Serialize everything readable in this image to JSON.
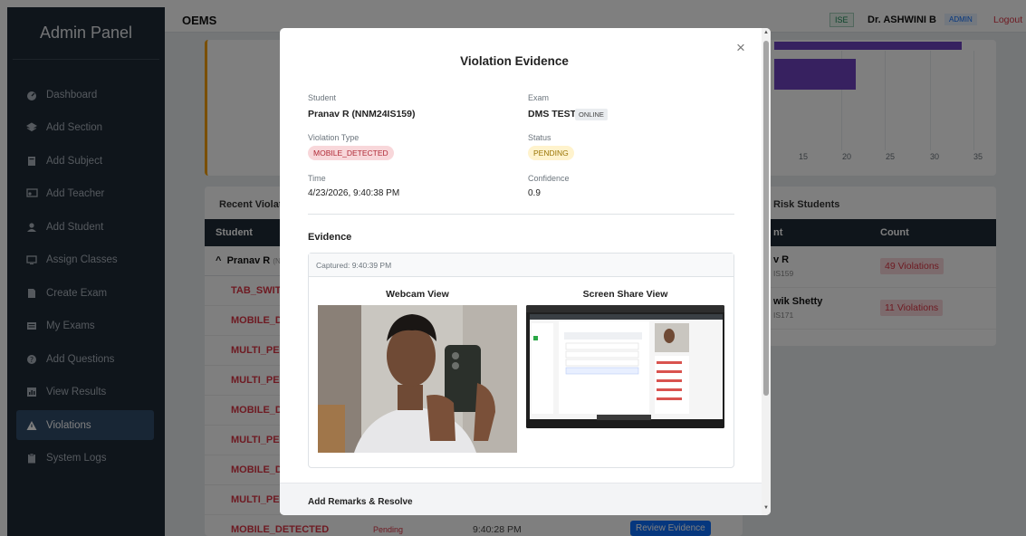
{
  "sidebar": {
    "brand": "Admin Panel",
    "items": [
      {
        "label": "Dashboard",
        "icon": "dashboard-icon"
      },
      {
        "label": "Add Section",
        "icon": "layers-icon"
      },
      {
        "label": "Add Subject",
        "icon": "book-icon"
      },
      {
        "label": "Add Teacher",
        "icon": "teacher-icon"
      },
      {
        "label": "Add Student",
        "icon": "student-icon"
      },
      {
        "label": "Assign Classes",
        "icon": "monitor-icon"
      },
      {
        "label": "Create Exam",
        "icon": "document-icon"
      },
      {
        "label": "My Exams",
        "icon": "list-icon"
      },
      {
        "label": "Add Questions",
        "icon": "question-icon"
      },
      {
        "label": "View Results",
        "icon": "chart-icon"
      },
      {
        "label": "Violations",
        "icon": "warning-icon",
        "active": true
      },
      {
        "label": "System Logs",
        "icon": "clipboard-icon"
      }
    ]
  },
  "topbar": {
    "app_name": "OEMS",
    "dept_badge": "ISE",
    "user_name": "Dr. ASHWINI B",
    "role_badge": "ADMIN",
    "logout": "Logout"
  },
  "chart": {
    "ticks": [
      "15",
      "20",
      "25",
      "30",
      "35"
    ]
  },
  "violations": {
    "title": "Recent Violati",
    "header_student": "Student",
    "group_label": "Pranav R",
    "group_suffix": "(N",
    "rows": [
      {
        "type": "TAB_SWITC"
      },
      {
        "type": "MOBILE_DE"
      },
      {
        "type": "MULTI_PER"
      },
      {
        "type": "MULTI_PER"
      },
      {
        "type": "MOBILE_DE"
      },
      {
        "type": "MULTI_PER"
      },
      {
        "type": "MOBILE_DE"
      },
      {
        "type": "MULTI_PER"
      },
      {
        "type": "MOBILE_DETECTED",
        "status": "Pending",
        "time": "9:40:28 PM",
        "action": "Review Evidence"
      }
    ]
  },
  "risk": {
    "title": "Risk Students",
    "header_student": "nt",
    "header_count": "Count",
    "rows": [
      {
        "name": "v R",
        "usn": "IS159",
        "count": "49 Violations"
      },
      {
        "name": "wik Shetty",
        "usn": "IS171",
        "count": "11 Violations"
      }
    ]
  },
  "modal": {
    "title": "Violation Evidence",
    "close": "×",
    "student_label": "Student",
    "student_value": "Pranav R (NNM24IS159)",
    "exam_label": "Exam",
    "exam_value": "DMS TEST",
    "exam_mode": "ONLINE",
    "vtype_label": "Violation Type",
    "vtype_value": "MOBILE_DETECTED",
    "status_label": "Status",
    "status_value": "PENDING",
    "time_label": "Time",
    "time_value": "4/23/2026, 9:40:38 PM",
    "confidence_label": "Confidence",
    "confidence_value": "0.9",
    "evidence_title": "Evidence",
    "captured": "Captured: 9:40:39 PM",
    "webcam_title": "Webcam View",
    "screen_title": "Screen Share View",
    "remarks_title": "Add Remarks & Resolve"
  },
  "colors": {
    "sidebar_bg": "#1e2a36",
    "active_nav": "#304c6b",
    "danger": "#dc3545",
    "bar_purple": "#6f42c1"
  }
}
